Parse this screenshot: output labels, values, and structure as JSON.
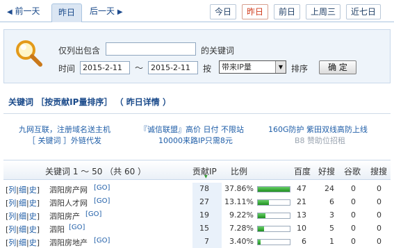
{
  "nav": {
    "prev_label": "前一天",
    "current_label": "昨日",
    "next_label": "后一天",
    "quick": [
      {
        "label": "今日",
        "selected": false
      },
      {
        "label": "昨日",
        "selected": true
      },
      {
        "label": "前日",
        "selected": false
      },
      {
        "label": "上周三",
        "selected": false
      },
      {
        "label": "近七日",
        "selected": false
      }
    ]
  },
  "filter": {
    "only_list_label": "仅列出包含",
    "keyword_value": "",
    "keyword_suffix": "的关键词",
    "time_label": "时间",
    "date_from": "2015-2-11",
    "tilde": "～",
    "date_to": "2015-2-11",
    "by_label": "按",
    "sort_value": "带来IP量",
    "order_label": "排序",
    "confirm_label": "确 定"
  },
  "section_title": "关键词 ［按贡献IP量排序］ （ 昨日详情 ）",
  "ads": {
    "col1_line1": "九网互联，注册域名送主机",
    "col1_line2": "［ 关键词 ］外链代发",
    "col2_line1": "『诚信联盟』高价 日付 不限站",
    "col2_line2": "10000来路IP只需8元",
    "col3_line1": "160G防护 紫田双线高防上线",
    "col3_line2": "B8 赞助位招租"
  },
  "table": {
    "headers": {
      "keyword": "关键词 1 ～ 50 （共 60 ）",
      "contrib": "贡献IP",
      "ratio": "比例",
      "baidu": "百度",
      "haosou": "好搜",
      "google": "谷歌",
      "sousou": "搜搜"
    },
    "link_list": "列",
    "link_detail": "细",
    "link_history": "史",
    "go_label": "[GO]",
    "rows": [
      {
        "keyword": "泗阳房产网",
        "contrib": "78",
        "ratio": "37.86%",
        "ratio_value": 0.3786,
        "baidu": "47",
        "haosou": "24",
        "google": "0",
        "sousou": "0"
      },
      {
        "keyword": "泗阳人才网",
        "contrib": "27",
        "ratio": "13.11%",
        "ratio_value": 0.1311,
        "baidu": "21",
        "haosou": "6",
        "google": "0",
        "sousou": "0"
      },
      {
        "keyword": "泗阳房产",
        "contrib": "19",
        "ratio": "9.22%",
        "ratio_value": 0.0922,
        "baidu": "13",
        "haosou": "3",
        "google": "0",
        "sousou": "0"
      },
      {
        "keyword": "泗阳",
        "contrib": "15",
        "ratio": "7.28%",
        "ratio_value": 0.0728,
        "baidu": "10",
        "haosou": "5",
        "google": "0",
        "sousou": "0"
      },
      {
        "keyword": "泗阳房地产",
        "contrib": "7",
        "ratio": "3.40%",
        "ratio_value": 0.034,
        "baidu": "6",
        "haosou": "1",
        "google": "0",
        "sousou": "0"
      }
    ]
  },
  "colors": {
    "link": "#1f5ea8",
    "selected_quick": "#d03a1a",
    "bar": "#2a9a2a"
  }
}
